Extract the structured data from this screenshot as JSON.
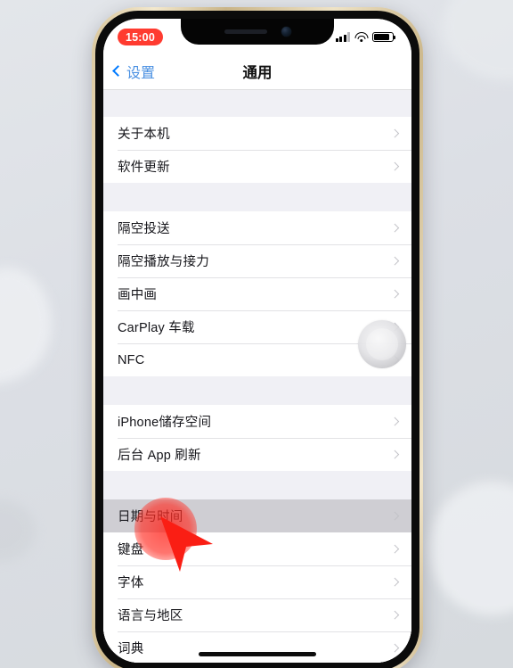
{
  "device": {
    "frame_color": "#d8c59b",
    "backdrop_color": "#dfe2e8",
    "notch": {
      "speaker": "speaker-grille",
      "camera": "front-camera"
    },
    "buttons": [
      "mute-switch",
      "volume-up",
      "volume-down",
      "power"
    ]
  },
  "status_bar": {
    "time": "15:00",
    "time_pill_color": "#ff3b30",
    "icons": [
      "signal-icon",
      "wifi-icon",
      "battery-icon"
    ],
    "battery_level_percent": 88
  },
  "nav_bar": {
    "back_label": "设置",
    "back_icon": "chevron-left-icon",
    "title": "通用",
    "accent_color": "#007aff"
  },
  "list": {
    "sections": [
      {
        "rows": [
          {
            "label": "关于本机",
            "accessory": "chevron-right-icon",
            "selected": false
          },
          {
            "label": "软件更新",
            "accessory": "chevron-right-icon",
            "selected": false
          }
        ]
      },
      {
        "rows": [
          {
            "label": "隔空投送",
            "accessory": "chevron-right-icon",
            "selected": false
          },
          {
            "label": "隔空播放与接力",
            "accessory": "chevron-right-icon",
            "selected": false
          },
          {
            "label": "画中画",
            "accessory": "chevron-right-icon",
            "selected": false
          },
          {
            "label": "CarPlay 车载",
            "accessory": "chevron-right-icon",
            "selected": false
          },
          {
            "label": "NFC",
            "accessory": "chevron-right-icon",
            "selected": false
          }
        ]
      },
      {
        "rows": [
          {
            "label": "iPhone储存空间",
            "accessory": "chevron-right-icon",
            "selected": false
          },
          {
            "label": "后台 App 刷新",
            "accessory": "chevron-right-icon",
            "selected": false
          }
        ]
      },
      {
        "rows": [
          {
            "label": "日期与时间",
            "accessory": "chevron-right-icon",
            "selected": true
          },
          {
            "label": "键盘",
            "accessory": "chevron-right-icon",
            "selected": false
          },
          {
            "label": "字体",
            "accessory": "chevron-right-icon",
            "selected": false
          },
          {
            "label": "语言与地区",
            "accessory": "chevron-right-icon",
            "selected": false
          },
          {
            "label": "词典",
            "accessory": "chevron-right-icon",
            "selected": false
          }
        ]
      }
    ]
  },
  "overlays": {
    "assistive_touch": "assistive-touch-button",
    "tap_highlight_color": "#ff241c",
    "cursor_color": "#fa1e14",
    "cursor": "mouse-cursor-arrow",
    "home_indicator": "home-indicator"
  }
}
